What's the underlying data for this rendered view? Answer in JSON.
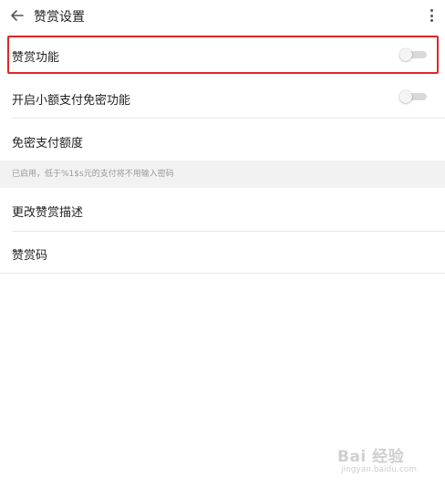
{
  "header": {
    "back_icon": "arrow-left-icon",
    "title": "赞赏设置",
    "more_icon": "more-vertical-icon"
  },
  "settings": {
    "reward_enabled": {
      "label": "赞赏功能",
      "on": false
    },
    "micro_pay": {
      "label": "开启小额支付免密功能",
      "on": false
    },
    "limit": {
      "label": "免密支付额度"
    },
    "hint": "已启用，低于%1$s元的支付将不用输入密码",
    "change_desc": {
      "label": "更改赞赏描述"
    },
    "reward_code": {
      "label": "赞赏码"
    }
  },
  "annotation": {
    "highlight_color": "#e32626"
  },
  "watermark": {
    "main": "Bai 经验",
    "sub": "jingyan.baidu.com"
  },
  "colors": {
    "divider": "#e7e7e7",
    "hint_bg": "#f2f2f2",
    "toggle_track": "#d9d9d9"
  }
}
